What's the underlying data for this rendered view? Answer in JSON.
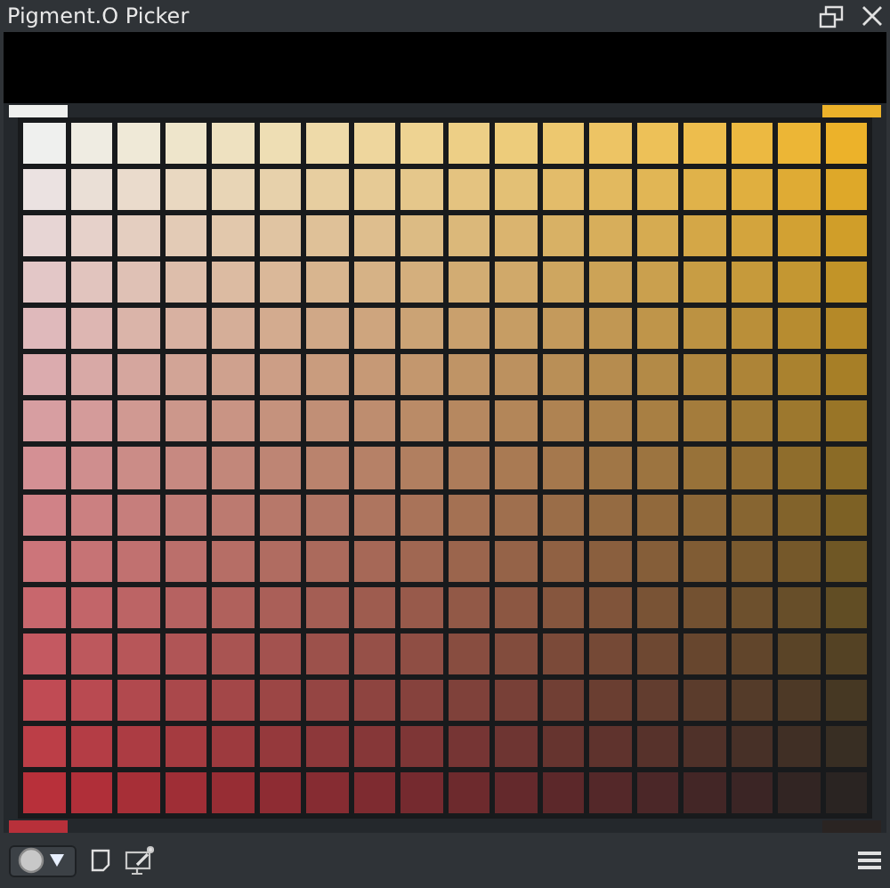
{
  "window": {
    "title": "Pigment.O Picker"
  },
  "corners": [
    {
      "kind": "top-left",
      "color": "#eff0ee"
    },
    {
      "kind": "top-right",
      "color": "#ecb22a"
    },
    {
      "kind": "bottom-left",
      "color": "#b8303a"
    },
    {
      "kind": "bottom-right",
      "color": "#2a2422"
    }
  ]
}
